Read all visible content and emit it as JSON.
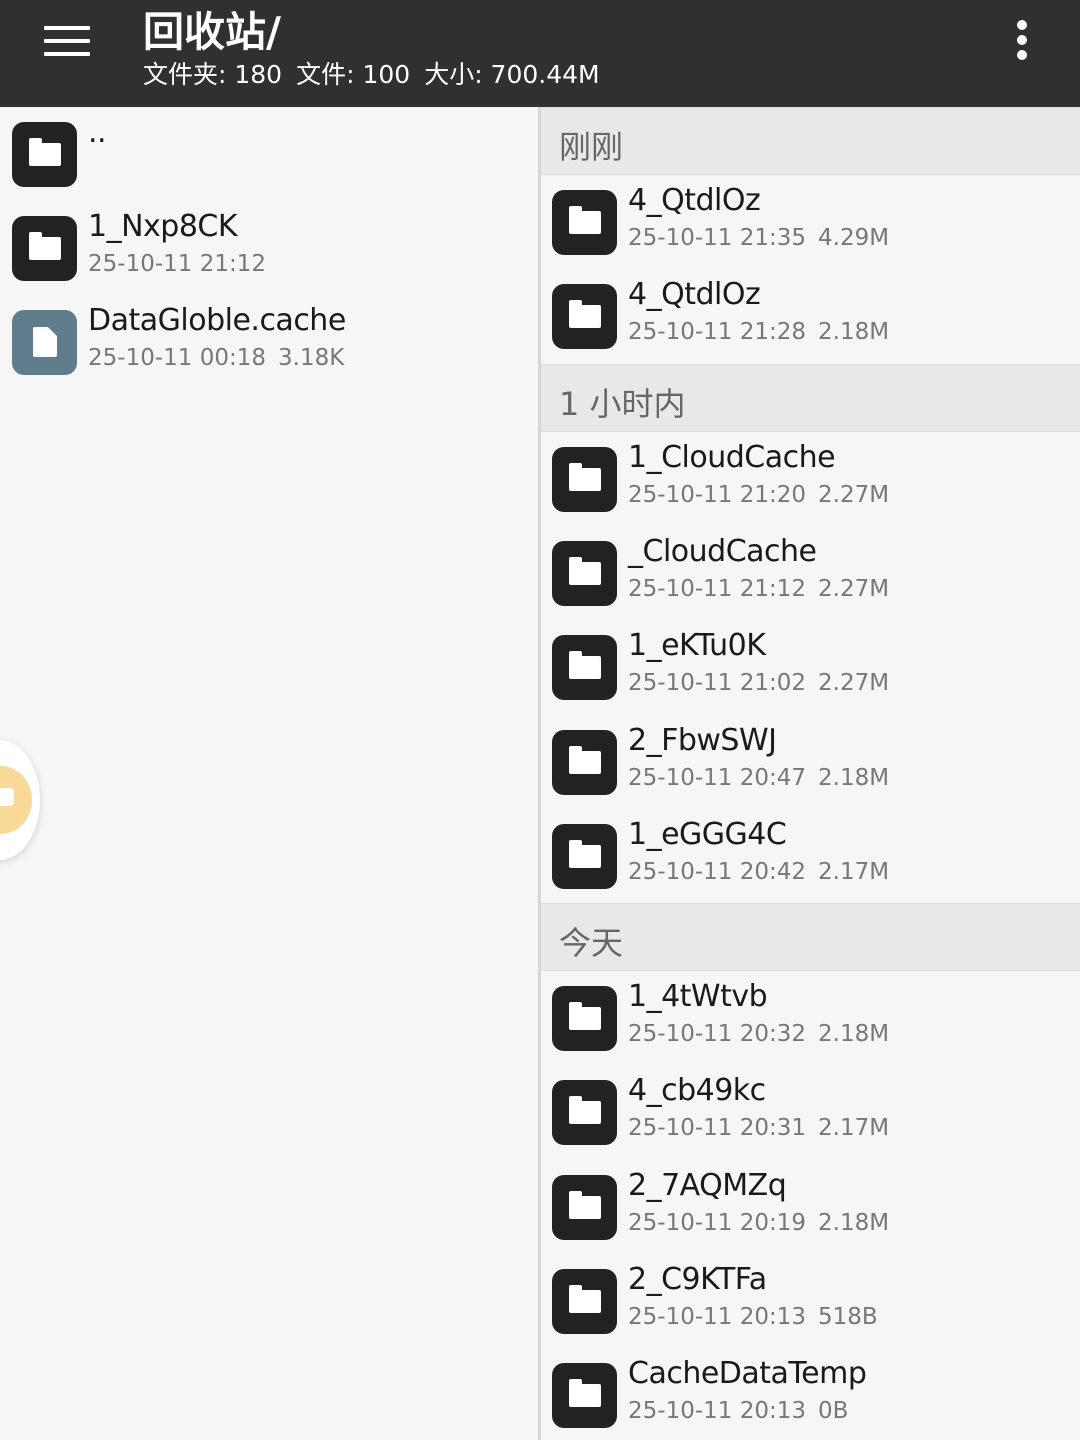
{
  "header": {
    "title": "回收站/",
    "stats": [
      "文件夹: 180",
      "文件: 100",
      "大小: 700.44M"
    ],
    "menu_icon": "hamburger-menu-icon",
    "more_icon": "more-vertical-icon"
  },
  "left_pane": {
    "items": [
      {
        "name": "..",
        "meta": "",
        "size": "",
        "type": "folder"
      },
      {
        "name": "1_Nxp8CK",
        "meta": "25-10-11 21:12",
        "size": "",
        "type": "folder"
      },
      {
        "name": "DataGloble.cache",
        "meta": "25-10-11 00:18",
        "size": "3.18K",
        "type": "file"
      }
    ]
  },
  "right_pane": {
    "sections": [
      {
        "label": "刚刚",
        "items": [
          {
            "name": "4_QtdlOz",
            "meta": "25-10-11 21:35",
            "size": "4.29M"
          },
          {
            "name": "4_QtdlOz",
            "meta": "25-10-11 21:28",
            "size": "2.18M"
          }
        ]
      },
      {
        "label": "1 小时内",
        "items": [
          {
            "name": "1_CloudCache",
            "meta": "25-10-11 21:20",
            "size": "2.27M"
          },
          {
            "name": "_CloudCache",
            "meta": "25-10-11 21:12",
            "size": "2.27M"
          },
          {
            "name": "1_eKTu0K",
            "meta": "25-10-11 21:02",
            "size": "2.27M"
          },
          {
            "name": "2_FbwSWJ",
            "meta": "25-10-11 20:47",
            "size": "2.18M"
          },
          {
            "name": "1_eGGG4C",
            "meta": "25-10-11 20:42",
            "size": "2.17M"
          }
        ]
      },
      {
        "label": "今天",
        "items": [
          {
            "name": "1_4tWtvb",
            "meta": "25-10-11 20:32",
            "size": "2.18M"
          },
          {
            "name": "4_cb49kc",
            "meta": "25-10-11 20:31",
            "size": "2.17M"
          },
          {
            "name": "2_7AQMZq",
            "meta": "25-10-11 20:19",
            "size": "2.18M"
          },
          {
            "name": "2_C9KTFa",
            "meta": "25-10-11 20:13",
            "size": "518B"
          },
          {
            "name": "CacheDataTemp",
            "meta": "25-10-11 20:13",
            "size": "0B"
          }
        ]
      }
    ]
  },
  "floating_ball": {
    "icon": "floating-assistant-icon",
    "color": "#f9d998"
  },
  "colors": {
    "toolbar": "#303030",
    "folder_icon": "#222222",
    "file_icon": "#5f7d8c",
    "section_bg": "#e8e8e8"
  }
}
